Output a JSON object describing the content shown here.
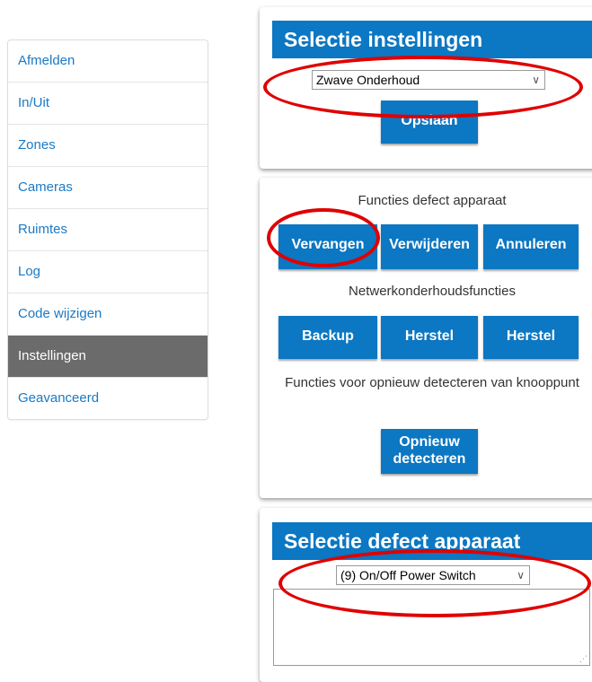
{
  "sidebar": {
    "items": [
      {
        "label": "Afmelden"
      },
      {
        "label": "In/Uit"
      },
      {
        "label": "Zones"
      },
      {
        "label": "Cameras"
      },
      {
        "label": "Ruimtes"
      },
      {
        "label": "Log"
      },
      {
        "label": "Code wijzigen"
      },
      {
        "label": "Instellingen"
      },
      {
        "label": "Geavanceerd"
      }
    ],
    "active": "Instellingen"
  },
  "selection_settings": {
    "title": "Selectie instellingen",
    "select_value": "Zwave Onderhoud",
    "save_button": "Opslaan"
  },
  "functions": {
    "defect_label": "Functies defect apparaat",
    "replace_button": "Vervangen",
    "remove_button": "Verwijderen",
    "cancel_button": "Annuleren",
    "network_label": "Netwerkonderhoudsfuncties",
    "backup_button": "Backup",
    "restore_button_1": "Herstel",
    "restore_button_2": "Herstel",
    "redetect_label": "Functies voor opnieuw detecteren van knooppunt",
    "redetect_button": "Opnieuw detecteren"
  },
  "defect_selection": {
    "title": "Selectie defect apparaat",
    "select_value": "(9) On/Off Power Switch"
  },
  "colors": {
    "accent": "#0c77c2",
    "link": "#1a7ac4",
    "active_nav": "#6b6b6b",
    "annotation": "#e00000"
  },
  "icons": {
    "select_chevron": "chevron-down-icon",
    "resize_handle": "resize-grip-icon"
  }
}
